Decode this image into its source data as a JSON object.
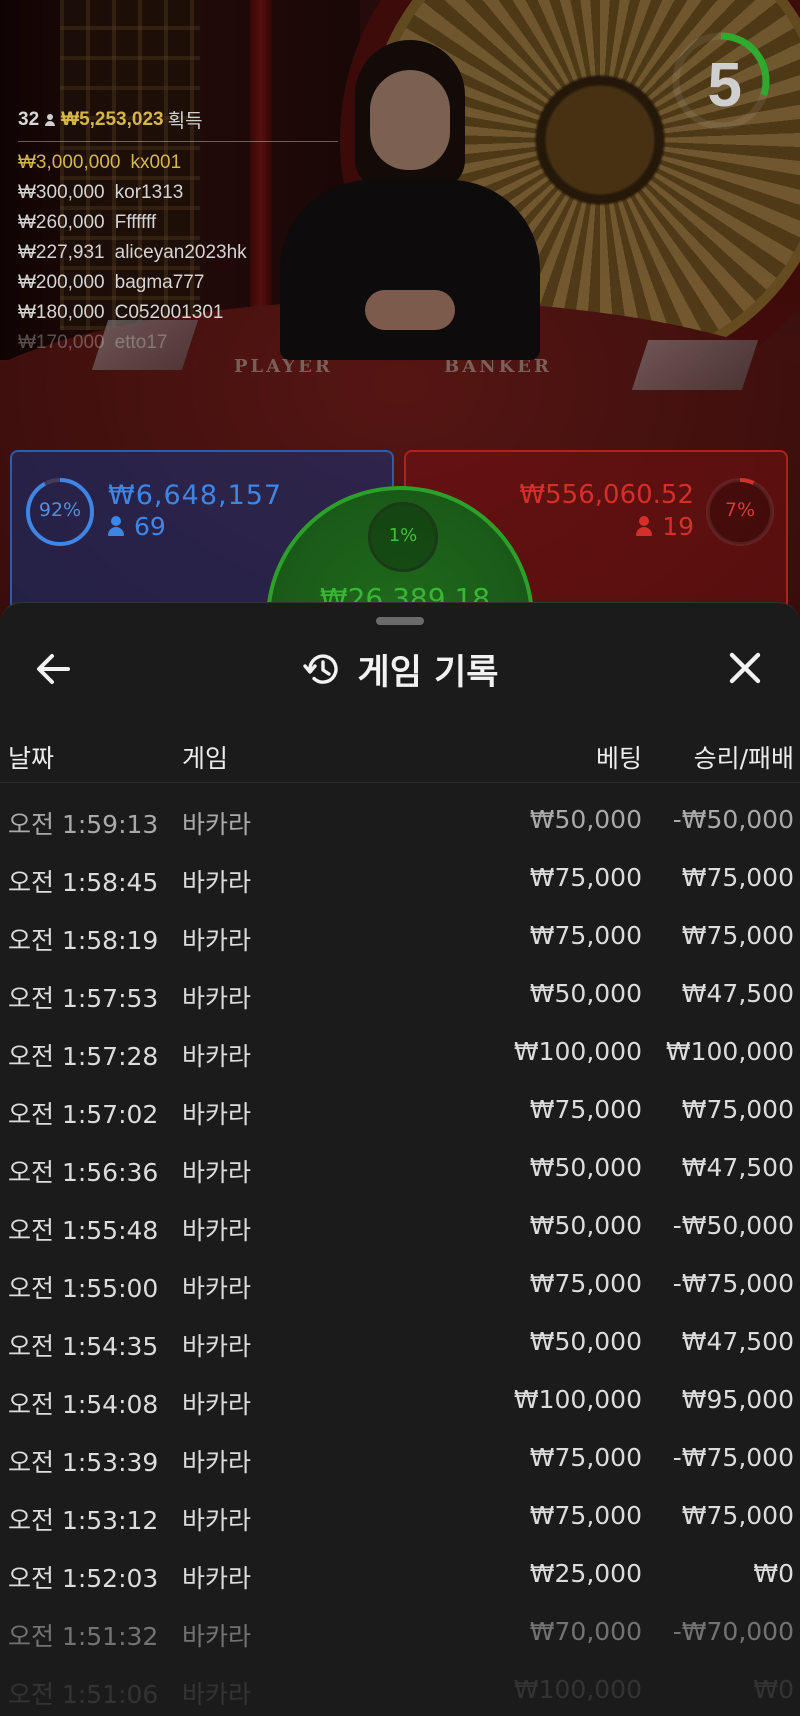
{
  "timer": {
    "value": "5",
    "progress": 0.3,
    "color": "#2faa2f"
  },
  "winners": {
    "count": "32",
    "total": "₩5,253,023",
    "label": "획득",
    "rows": [
      {
        "amount": "₩3,000,000",
        "user": "kx001"
      },
      {
        "amount": "₩300,000",
        "user": "kor1313"
      },
      {
        "amount": "₩260,000",
        "user": "Fffffff"
      },
      {
        "amount": "₩227,931",
        "user": "aliceyan2023hk"
      },
      {
        "amount": "₩200,000",
        "user": "bagma777"
      },
      {
        "amount": "₩180,000",
        "user": "C052001301"
      },
      {
        "amount": "₩170,000",
        "user": "etto17"
      }
    ]
  },
  "table_labels": {
    "player": "PLAYER",
    "banker": "BANKER"
  },
  "player_bet": {
    "percent": "92%",
    "percent_value": 0.92,
    "amount": "₩6,648,157",
    "players": "69",
    "color": "#3d86e6"
  },
  "banker_bet": {
    "percent": "7%",
    "percent_value": 0.07,
    "amount": "₩556,060.52",
    "players": "19",
    "color": "#d3302a"
  },
  "tie_bet": {
    "percent": "1%",
    "amount": "₩26,389.18",
    "color": "#2ca12a"
  },
  "sheet": {
    "title": "게임 기록",
    "icons": {
      "back": "back-arrow-icon",
      "history": "history-icon",
      "close": "close-icon"
    },
    "columns": {
      "date": "날짜",
      "game": "게임",
      "bet": "베팅",
      "result": "승리/패배"
    },
    "rows": [
      {
        "date": "오전 1:59:13",
        "game": "바카라",
        "bet": "₩50,000",
        "result": "-₩50,000"
      },
      {
        "date": "오전 1:58:45",
        "game": "바카라",
        "bet": "₩75,000",
        "result": "₩75,000"
      },
      {
        "date": "오전 1:58:19",
        "game": "바카라",
        "bet": "₩75,000",
        "result": "₩75,000"
      },
      {
        "date": "오전 1:57:53",
        "game": "바카라",
        "bet": "₩50,000",
        "result": "₩47,500"
      },
      {
        "date": "오전 1:57:28",
        "game": "바카라",
        "bet": "₩100,000",
        "result": "₩100,000"
      },
      {
        "date": "오전 1:57:02",
        "game": "바카라",
        "bet": "₩75,000",
        "result": "₩75,000"
      },
      {
        "date": "오전 1:56:36",
        "game": "바카라",
        "bet": "₩50,000",
        "result": "₩47,500"
      },
      {
        "date": "오전 1:55:48",
        "game": "바카라",
        "bet": "₩50,000",
        "result": "-₩50,000"
      },
      {
        "date": "오전 1:55:00",
        "game": "바카라",
        "bet": "₩75,000",
        "result": "-₩75,000"
      },
      {
        "date": "오전 1:54:35",
        "game": "바카라",
        "bet": "₩50,000",
        "result": "₩47,500"
      },
      {
        "date": "오전 1:54:08",
        "game": "바카라",
        "bet": "₩100,000",
        "result": "₩95,000"
      },
      {
        "date": "오전 1:53:39",
        "game": "바카라",
        "bet": "₩75,000",
        "result": "-₩75,000"
      },
      {
        "date": "오전 1:53:12",
        "game": "바카라",
        "bet": "₩75,000",
        "result": "₩75,000"
      },
      {
        "date": "오전 1:52:03",
        "game": "바카라",
        "bet": "₩25,000",
        "result": "₩0"
      },
      {
        "date": "오전 1:51:32",
        "game": "바카라",
        "bet": "₩70,000",
        "result": "-₩70,000"
      },
      {
        "date": "오전 1:51:06",
        "game": "바카라",
        "bet": "₩100,000",
        "result": "₩0"
      }
    ]
  }
}
